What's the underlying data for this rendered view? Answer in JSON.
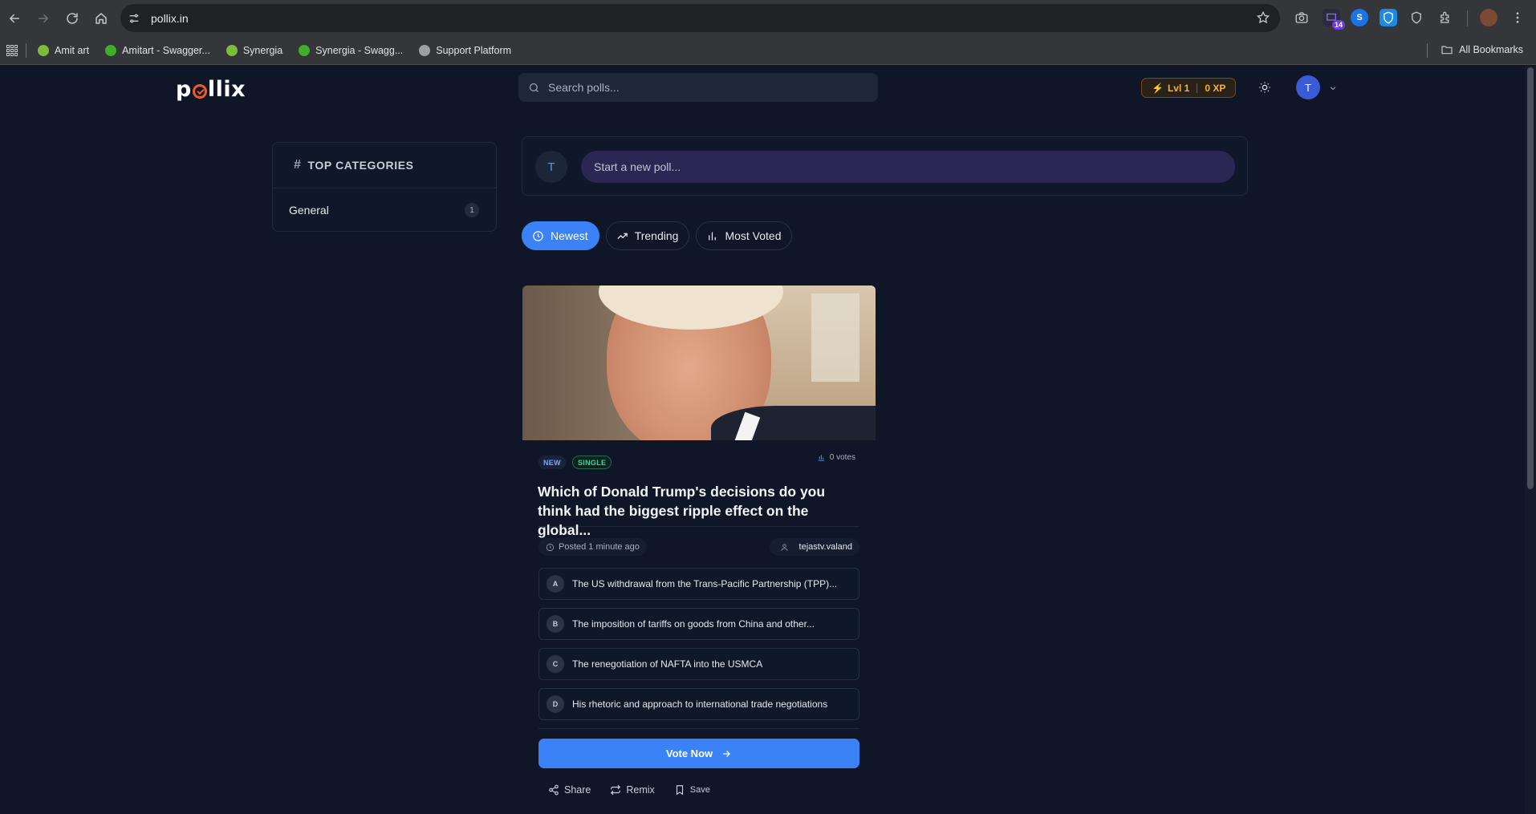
{
  "browser": {
    "url": "pollix.in",
    "extension_badge": "14",
    "bookmarks": [
      {
        "label": "Amit art",
        "color": "#7dbb3c"
      },
      {
        "label": "Amitart - Swagger...",
        "color": "#3fae2a"
      },
      {
        "label": "Synergia",
        "color": "#7dbb3c"
      },
      {
        "label": "Synergia - Swagg...",
        "color": "#3fae2a"
      },
      {
        "label": "Support Platform",
        "color": "#9aa0a6"
      }
    ],
    "all_bookmarks_label": "All Bookmarks"
  },
  "header": {
    "logo_prefix": "p",
    "logo_suffix": "llix",
    "search_placeholder": "Search polls...",
    "level_label": "Lvl 1",
    "xp_label": "0 XP",
    "avatar_initial": "T",
    "accent_color": "#3b82f6"
  },
  "sidebar": {
    "title": "TOP CATEGORIES",
    "categories": [
      {
        "name": "General",
        "count": "1"
      }
    ]
  },
  "composer": {
    "avatar_initial": "T",
    "placeholder": "Start a new poll..."
  },
  "tabs": [
    {
      "label": "Newest",
      "icon": "clock-icon",
      "active": true
    },
    {
      "label": "Trending",
      "icon": "trending-up-icon",
      "active": false
    },
    {
      "label": "Most Voted",
      "icon": "bar-chart-icon",
      "active": false
    }
  ],
  "poll": {
    "badges": [
      "NEW",
      "SINGLE"
    ],
    "votes": "0 votes",
    "title": "Which of Donald Trump's decisions do you think had the biggest ripple effect on the global...",
    "posted": "Posted 1 minute ago",
    "author": "tejastv.valand",
    "options": [
      {
        "letter": "A",
        "text": "The US withdrawal from the Trans-Pacific Partnership (TPP)..."
      },
      {
        "letter": "B",
        "text": "The imposition of tariffs on goods from China and other..."
      },
      {
        "letter": "C",
        "text": "The renegotiation of NAFTA into the USMCA"
      },
      {
        "letter": "D",
        "text": "His rhetoric and approach to international trade negotiations"
      }
    ],
    "vote_button": "Vote Now",
    "actions": {
      "share": "Share",
      "remix": "Remix",
      "save": "Save"
    }
  }
}
